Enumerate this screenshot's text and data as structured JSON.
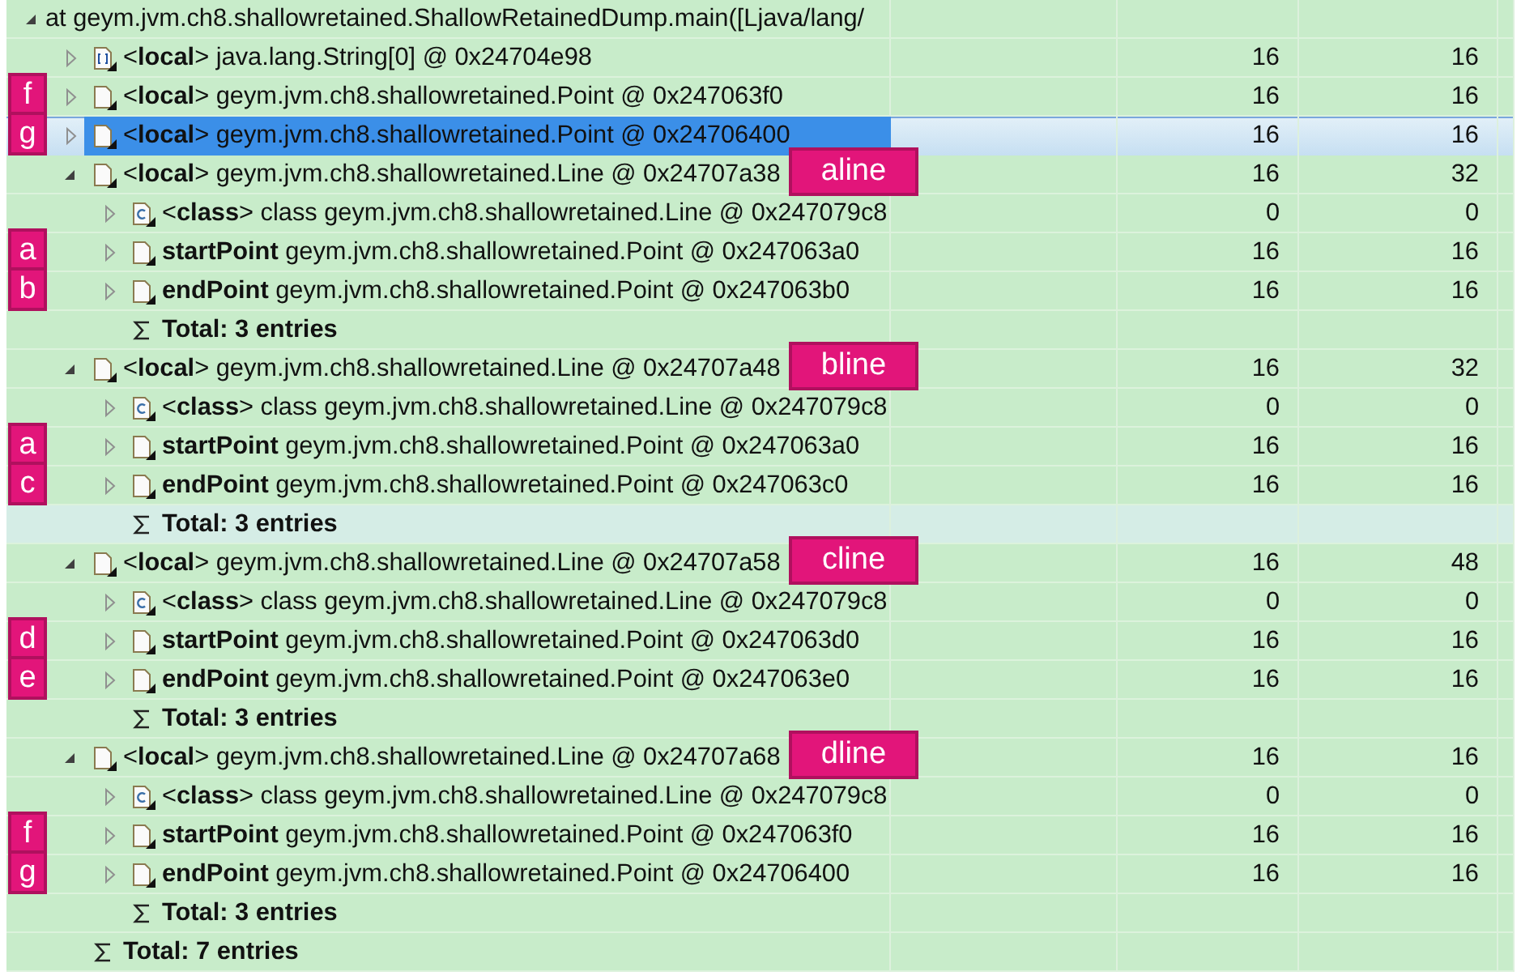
{
  "tree": [
    {
      "kind": "frame",
      "text": "at geym.jvm.ch8.shallowretained.ShallowRetainedDump.main([Ljava/lang/",
      "expanded": true,
      "selected": false,
      "hovered": false,
      "children": [
        {
          "kind": "array",
          "text": "<**local**> java.lang.String[0] @ 0x24704e98",
          "expanded": false,
          "selected": false,
          "hovered": false,
          "shallow": "16",
          "retained": "16"
        },
        {
          "kind": "object",
          "text": "<**local**> geym.jvm.ch8.shallowretained.Point @ 0x247063f0",
          "expanded": false,
          "selected": false,
          "hovered": false,
          "shallow": "16",
          "retained": "16",
          "marker": "f"
        },
        {
          "kind": "object",
          "text": "<**local**> geym.jvm.ch8.shallowretained.Point @ 0x24706400",
          "expanded": false,
          "selected": true,
          "hovered": false,
          "shallow": "16",
          "retained": "16",
          "marker": "g"
        },
        {
          "kind": "object",
          "text": "<**local**> geym.jvm.ch8.shallowretained.Line @ 0x24707a38",
          "expanded": true,
          "selected": false,
          "hovered": false,
          "shallow": "16",
          "retained": "32",
          "callout": "aline",
          "children": [
            {
              "kind": "class",
              "text": "<**class**> class geym.jvm.ch8.shallowretained.Line @ 0x247079c8",
              "expanded": false,
              "selected": false,
              "hovered": false,
              "shallow": "0",
              "retained": "0"
            },
            {
              "kind": "object",
              "text": "**startPoint** geym.jvm.ch8.shallowretained.Point @ 0x247063a0",
              "expanded": false,
              "selected": false,
              "hovered": false,
              "shallow": "16",
              "retained": "16",
              "marker": "a"
            },
            {
              "kind": "object",
              "text": "**endPoint** geym.jvm.ch8.shallowretained.Point @ 0x247063b0",
              "expanded": false,
              "selected": false,
              "hovered": false,
              "shallow": "16",
              "retained": "16",
              "marker": "b"
            },
            {
              "kind": "total",
              "text": "Total: 3 entries",
              "selected": false,
              "hovered": false
            }
          ]
        },
        {
          "kind": "object",
          "text": "<**local**> geym.jvm.ch8.shallowretained.Line @ 0x24707a48",
          "expanded": true,
          "selected": false,
          "hovered": false,
          "shallow": "16",
          "retained": "32",
          "callout": "bline",
          "children": [
            {
              "kind": "class",
              "text": "<**class**> class geym.jvm.ch8.shallowretained.Line @ 0x247079c8",
              "expanded": false,
              "selected": false,
              "hovered": false,
              "shallow": "0",
              "retained": "0"
            },
            {
              "kind": "object",
              "text": "**startPoint** geym.jvm.ch8.shallowretained.Point @ 0x247063a0",
              "expanded": false,
              "selected": false,
              "hovered": false,
              "shallow": "16",
              "retained": "16",
              "marker": "a"
            },
            {
              "kind": "object",
              "text": "**endPoint** geym.jvm.ch8.shallowretained.Point @ 0x247063c0",
              "expanded": false,
              "selected": false,
              "hovered": false,
              "shallow": "16",
              "retained": "16",
              "marker": "c"
            },
            {
              "kind": "total",
              "text": "Total: 3 entries",
              "selected": false,
              "hovered": true
            }
          ]
        },
        {
          "kind": "object",
          "text": "<**local**> geym.jvm.ch8.shallowretained.Line @ 0x24707a58",
          "expanded": true,
          "selected": false,
          "hovered": false,
          "shallow": "16",
          "retained": "48",
          "callout": "cline",
          "children": [
            {
              "kind": "class",
              "text": "<**class**> class geym.jvm.ch8.shallowretained.Line @ 0x247079c8",
              "expanded": false,
              "selected": false,
              "hovered": false,
              "shallow": "0",
              "retained": "0"
            },
            {
              "kind": "object",
              "text": "**startPoint** geym.jvm.ch8.shallowretained.Point @ 0x247063d0",
              "expanded": false,
              "selected": false,
              "hovered": false,
              "shallow": "16",
              "retained": "16",
              "marker": "d"
            },
            {
              "kind": "object",
              "text": "**endPoint** geym.jvm.ch8.shallowretained.Point @ 0x247063e0",
              "expanded": false,
              "selected": false,
              "hovered": false,
              "shallow": "16",
              "retained": "16",
              "marker": "e"
            },
            {
              "kind": "total",
              "text": "Total: 3 entries",
              "selected": false,
              "hovered": false
            }
          ]
        },
        {
          "kind": "object",
          "text": "<**local**> geym.jvm.ch8.shallowretained.Line @ 0x24707a68",
          "expanded": true,
          "selected": false,
          "hovered": false,
          "shallow": "16",
          "retained": "16",
          "callout": "dline",
          "children": [
            {
              "kind": "class",
              "text": "<**class**> class geym.jvm.ch8.shallowretained.Line @ 0x247079c8",
              "expanded": false,
              "selected": false,
              "hovered": false,
              "shallow": "0",
              "retained": "0"
            },
            {
              "kind": "object",
              "text": "**startPoint** geym.jvm.ch8.shallowretained.Point @ 0x247063f0",
              "expanded": false,
              "selected": false,
              "hovered": false,
              "shallow": "16",
              "retained": "16",
              "marker": "f"
            },
            {
              "kind": "object",
              "text": "**endPoint** geym.jvm.ch8.shallowretained.Point @ 0x24706400",
              "expanded": false,
              "selected": false,
              "hovered": false,
              "shallow": "16",
              "retained": "16",
              "marker": "g"
            },
            {
              "kind": "total",
              "text": "Total: 3 entries",
              "selected": false,
              "hovered": false
            }
          ]
        },
        {
          "kind": "total",
          "text": "Total: 7 entries",
          "selected": false,
          "hovered": false
        }
      ]
    }
  ]
}
